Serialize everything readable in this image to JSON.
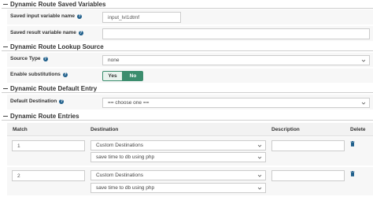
{
  "sections": {
    "saved_variables": "Dynamic Route Saved Variables",
    "lookup_source": "Dynamic Route Lookup Source",
    "default_entry": "Dynamic Route Default Entry",
    "entries": "Dynamic Route Entries"
  },
  "saved_input": {
    "label": "Saved input variable name",
    "value": "input_lvl1dtmf"
  },
  "saved_result": {
    "label": "Saved result variable name",
    "value": ""
  },
  "source_type": {
    "label": "Source Type",
    "value": "none"
  },
  "substitutions": {
    "label": "Enable substitutions",
    "yes": "Yes",
    "no": "No",
    "selected": "No"
  },
  "default_destination": {
    "label": "Default Destination",
    "value": "== choose one =="
  },
  "table": {
    "headers": {
      "match": "Match",
      "destination": "Destination",
      "description": "Description",
      "delete": "Delete"
    },
    "rows": [
      {
        "match": "1",
        "dest_type": "Custom Destinations",
        "dest_target": "save time to db using php",
        "description": ""
      },
      {
        "match": "2",
        "dest_type": "Custom Destinations",
        "dest_target": "save time to db using php",
        "description": ""
      }
    ]
  },
  "colors": {
    "accent": "#3c8d6e",
    "help": "#1f5f8b",
    "trash": "#1f5f8b"
  },
  "icons": {
    "help": "question-circle-icon",
    "select": "chevron-down-icon",
    "delete": "trash-icon"
  }
}
